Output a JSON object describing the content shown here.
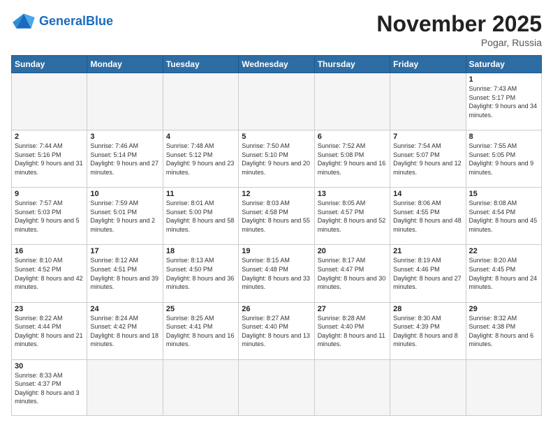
{
  "header": {
    "logo_general": "General",
    "logo_blue": "Blue",
    "month_title": "November 2025",
    "location": "Pogar, Russia"
  },
  "weekdays": [
    "Sunday",
    "Monday",
    "Tuesday",
    "Wednesday",
    "Thursday",
    "Friday",
    "Saturday"
  ],
  "days": {
    "d1": {
      "num": "1",
      "sunrise": "7:43 AM",
      "sunset": "5:17 PM",
      "daylight": "9 hours and 34 minutes."
    },
    "d2": {
      "num": "2",
      "sunrise": "7:44 AM",
      "sunset": "5:16 PM",
      "daylight": "9 hours and 31 minutes."
    },
    "d3": {
      "num": "3",
      "sunrise": "7:46 AM",
      "sunset": "5:14 PM",
      "daylight": "9 hours and 27 minutes."
    },
    "d4": {
      "num": "4",
      "sunrise": "7:48 AM",
      "sunset": "5:12 PM",
      "daylight": "9 hours and 23 minutes."
    },
    "d5": {
      "num": "5",
      "sunrise": "7:50 AM",
      "sunset": "5:10 PM",
      "daylight": "9 hours and 20 minutes."
    },
    "d6": {
      "num": "6",
      "sunrise": "7:52 AM",
      "sunset": "5:08 PM",
      "daylight": "9 hours and 16 minutes."
    },
    "d7": {
      "num": "7",
      "sunrise": "7:54 AM",
      "sunset": "5:07 PM",
      "daylight": "9 hours and 12 minutes."
    },
    "d8": {
      "num": "8",
      "sunrise": "7:55 AM",
      "sunset": "5:05 PM",
      "daylight": "9 hours and 9 minutes."
    },
    "d9": {
      "num": "9",
      "sunrise": "7:57 AM",
      "sunset": "5:03 PM",
      "daylight": "9 hours and 5 minutes."
    },
    "d10": {
      "num": "10",
      "sunrise": "7:59 AM",
      "sunset": "5:01 PM",
      "daylight": "9 hours and 2 minutes."
    },
    "d11": {
      "num": "11",
      "sunrise": "8:01 AM",
      "sunset": "5:00 PM",
      "daylight": "8 hours and 58 minutes."
    },
    "d12": {
      "num": "12",
      "sunrise": "8:03 AM",
      "sunset": "4:58 PM",
      "daylight": "8 hours and 55 minutes."
    },
    "d13": {
      "num": "13",
      "sunrise": "8:05 AM",
      "sunset": "4:57 PM",
      "daylight": "8 hours and 52 minutes."
    },
    "d14": {
      "num": "14",
      "sunrise": "8:06 AM",
      "sunset": "4:55 PM",
      "daylight": "8 hours and 48 minutes."
    },
    "d15": {
      "num": "15",
      "sunrise": "8:08 AM",
      "sunset": "4:54 PM",
      "daylight": "8 hours and 45 minutes."
    },
    "d16": {
      "num": "16",
      "sunrise": "8:10 AM",
      "sunset": "4:52 PM",
      "daylight": "8 hours and 42 minutes."
    },
    "d17": {
      "num": "17",
      "sunrise": "8:12 AM",
      "sunset": "4:51 PM",
      "daylight": "8 hours and 39 minutes."
    },
    "d18": {
      "num": "18",
      "sunrise": "8:13 AM",
      "sunset": "4:50 PM",
      "daylight": "8 hours and 36 minutes."
    },
    "d19": {
      "num": "19",
      "sunrise": "8:15 AM",
      "sunset": "4:48 PM",
      "daylight": "8 hours and 33 minutes."
    },
    "d20": {
      "num": "20",
      "sunrise": "8:17 AM",
      "sunset": "4:47 PM",
      "daylight": "8 hours and 30 minutes."
    },
    "d21": {
      "num": "21",
      "sunrise": "8:19 AM",
      "sunset": "4:46 PM",
      "daylight": "8 hours and 27 minutes."
    },
    "d22": {
      "num": "22",
      "sunrise": "8:20 AM",
      "sunset": "4:45 PM",
      "daylight": "8 hours and 24 minutes."
    },
    "d23": {
      "num": "23",
      "sunrise": "8:22 AM",
      "sunset": "4:44 PM",
      "daylight": "8 hours and 21 minutes."
    },
    "d24": {
      "num": "24",
      "sunrise": "8:24 AM",
      "sunset": "4:42 PM",
      "daylight": "8 hours and 18 minutes."
    },
    "d25": {
      "num": "25",
      "sunrise": "8:25 AM",
      "sunset": "4:41 PM",
      "daylight": "8 hours and 16 minutes."
    },
    "d26": {
      "num": "26",
      "sunrise": "8:27 AM",
      "sunset": "4:40 PM",
      "daylight": "8 hours and 13 minutes."
    },
    "d27": {
      "num": "27",
      "sunrise": "8:28 AM",
      "sunset": "4:40 PM",
      "daylight": "8 hours and 11 minutes."
    },
    "d28": {
      "num": "28",
      "sunrise": "8:30 AM",
      "sunset": "4:39 PM",
      "daylight": "8 hours and 8 minutes."
    },
    "d29": {
      "num": "29",
      "sunrise": "8:32 AM",
      "sunset": "4:38 PM",
      "daylight": "8 hours and 6 minutes."
    },
    "d30": {
      "num": "30",
      "sunrise": "8:33 AM",
      "sunset": "4:37 PM",
      "daylight": "8 hours and 3 minutes."
    },
    "label_sunrise": "Sunrise:",
    "label_sunset": "Sunset:",
    "label_daylight": "Daylight:"
  }
}
